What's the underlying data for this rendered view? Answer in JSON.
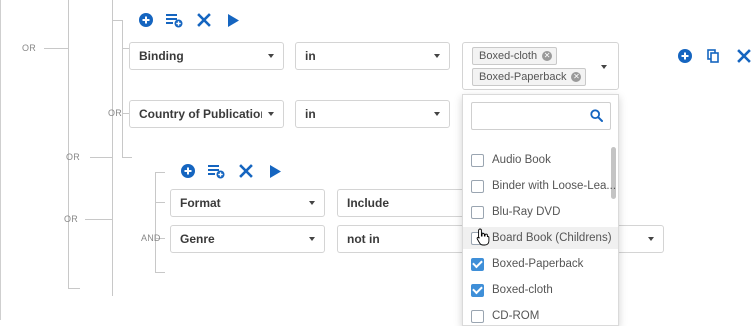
{
  "colors": {
    "accent": "#1565c0",
    "checkbox_checked": "#3f8fd8"
  },
  "operators": {
    "or": "OR",
    "and": "AND"
  },
  "group1": {
    "row1": {
      "field": "Binding",
      "operator": "in",
      "selected_chips": [
        "Boxed-cloth",
        "Boxed-Paperback"
      ]
    },
    "row2": {
      "field": "Country of Publication",
      "operator": "in"
    }
  },
  "group2": {
    "row1": {
      "field": "Format",
      "operator": "Include"
    },
    "row2": {
      "field": "Genre",
      "operator": "not in"
    }
  },
  "toolbar_icons": [
    "add-circle-icon",
    "add-list-icon",
    "close-icon",
    "play-icon"
  ],
  "row_action_icons": [
    "add-circle-icon",
    "copy-icon",
    "close-icon"
  ],
  "dropdown": {
    "search_value": "",
    "options": [
      {
        "label": "Audio Book",
        "checked": false
      },
      {
        "label": "Binder with Loose-Lea...",
        "checked": false
      },
      {
        "label": "Blu-Ray DVD",
        "checked": false
      },
      {
        "label": "Board Book (Childrens)",
        "checked": false,
        "hovered": true
      },
      {
        "label": "Boxed-Paperback",
        "checked": true
      },
      {
        "label": "Boxed-cloth",
        "checked": true
      },
      {
        "label": "CD-ROM",
        "checked": false
      }
    ]
  }
}
